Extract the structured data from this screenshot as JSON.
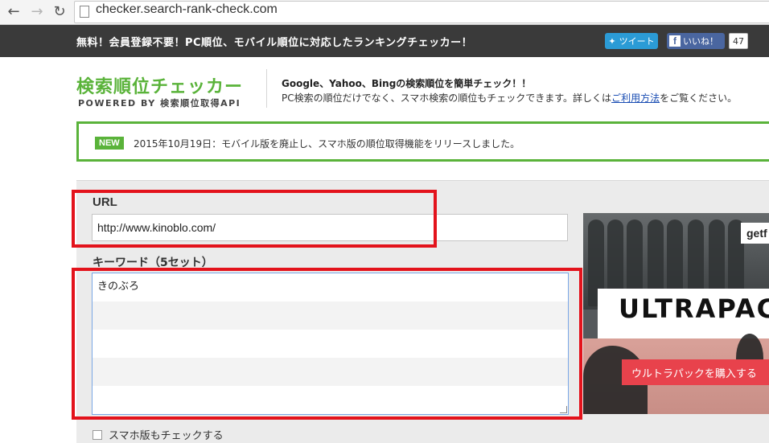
{
  "browser": {
    "url": "checker.search-rank-check.com"
  },
  "header": {
    "tagline": "無料！会員登録不要！PC順位、モバイル順位に対応したランキングチェッカー！",
    "tweet_label": "ツイート",
    "like_label": "いいね！",
    "like_count": "47"
  },
  "logo": {
    "title": "検索順位チェッカー",
    "subtitle": "POWERED BY 検索順位取得API"
  },
  "description": {
    "line1": "Google、Yahoo、Bingの検索順位を簡単チェック！！",
    "line2_before": "PC検索の順位だけでなく、スマホ検索の順位もチェックできます。詳しくは",
    "line2_link": "ご利用方法",
    "line2_after": "をご覧ください。"
  },
  "news": {
    "badge": "NEW",
    "text": "2015年10月19日：モバイル版を廃止し、スマホ版の順位取得機能をリリースしました。"
  },
  "form": {
    "url_label": "URL",
    "url_value": "http://www.kinoblo.com/",
    "keyword_label": "キーワード（5セット）",
    "keywords": [
      "きのぶろ",
      "",
      "",
      "",
      ""
    ],
    "smartphone_check_label": "スマホ版もチェックする"
  },
  "ad": {
    "chip": "getf",
    "brand": "ULTRAPACK",
    "cta": "ウルトラパックを購入する"
  },
  "colors": {
    "accent_green": "#5ab33a",
    "highlight_red": "#e3131c",
    "header_dark": "#3a3a3a",
    "link_blue": "#1a4db3"
  }
}
